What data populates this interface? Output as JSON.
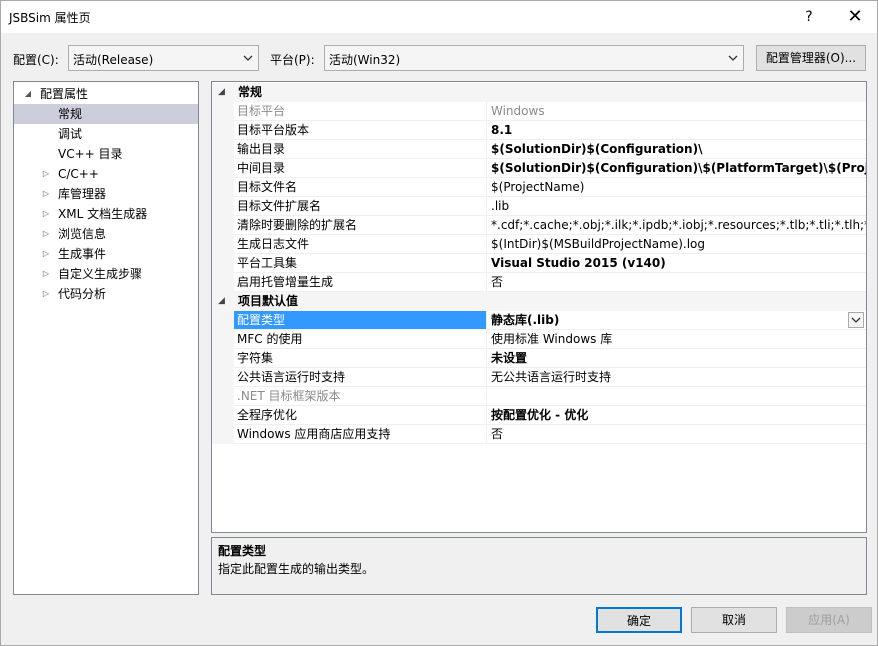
{
  "window": {
    "title": "JSBSim 属性页",
    "help_glyph": "?",
    "close_glyph": "✕"
  },
  "toolbar": {
    "config_label": "配置(C):",
    "config_value": "活动(Release)",
    "platform_label": "平台(P):",
    "platform_value": "活动(Win32)",
    "config_manager_label": "配置管理器(O)..."
  },
  "tree": {
    "items": [
      {
        "label": "配置属性",
        "expander": "◢"
      },
      {
        "label": "常规",
        "expander": ""
      },
      {
        "label": "调试",
        "expander": ""
      },
      {
        "label": "VC++ 目录",
        "expander": ""
      },
      {
        "label": "C/C++",
        "expander": "▷"
      },
      {
        "label": "库管理器",
        "expander": "▷"
      },
      {
        "label": "XML 文档生成器",
        "expander": "▷"
      },
      {
        "label": "浏览信息",
        "expander": "▷"
      },
      {
        "label": "生成事件",
        "expander": "▷"
      },
      {
        "label": "自定义生成步骤",
        "expander": "▷"
      },
      {
        "label": "代码分析",
        "expander": "▷"
      }
    ]
  },
  "grid": {
    "sections": [
      {
        "label": "常规",
        "expander": "◢"
      },
      {
        "label": "项目默认值",
        "expander": "◢"
      }
    ],
    "rows": [
      {
        "name": "目标平台",
        "value": "Windows"
      },
      {
        "name": "目标平台版本",
        "value": "8.1"
      },
      {
        "name": "输出目录",
        "value": "$(SolutionDir)$(Configuration)\\"
      },
      {
        "name": "中间目录",
        "value": "$(SolutionDir)$(Configuration)\\$(PlatformTarget)\\$(ProjectN"
      },
      {
        "name": "目标文件名",
        "value": "$(ProjectName)"
      },
      {
        "name": "目标文件扩展名",
        "value": ".lib"
      },
      {
        "name": "清除时要删除的扩展名",
        "value": "*.cdf;*.cache;*.obj;*.ilk;*.ipdb;*.iobj;*.resources;*.tlb;*.tli;*.tlh;*.tmp;*"
      },
      {
        "name": "生成日志文件",
        "value": "$(IntDir)$(MSBuildProjectName).log"
      },
      {
        "name": "平台工具集",
        "value": "Visual Studio 2015 (v140)"
      },
      {
        "name": "启用托管增量生成",
        "value": "否"
      },
      {
        "name": "配置类型",
        "value": "静态库(.lib)"
      },
      {
        "name": "MFC 的使用",
        "value": "使用标准 Windows 库"
      },
      {
        "name": "字符集",
        "value": "未设置"
      },
      {
        "name": "公共语言运行时支持",
        "value": "无公共语言运行时支持"
      },
      {
        "name": ".NET 目标框架版本",
        "value": ""
      },
      {
        "name": "全程序优化",
        "value": "按配置优化 - 优化"
      },
      {
        "name": "Windows 应用商店应用支持",
        "value": "否"
      }
    ]
  },
  "description": {
    "title": "配置类型",
    "text": "指定此配置生成的输出类型。"
  },
  "buttons": {
    "ok": "确定",
    "cancel": "取消",
    "apply": "应用(A)"
  },
  "colors": {
    "selection": "#3399ff",
    "tree_selection": "#cccedb",
    "focus_border": "#0078d7"
  }
}
